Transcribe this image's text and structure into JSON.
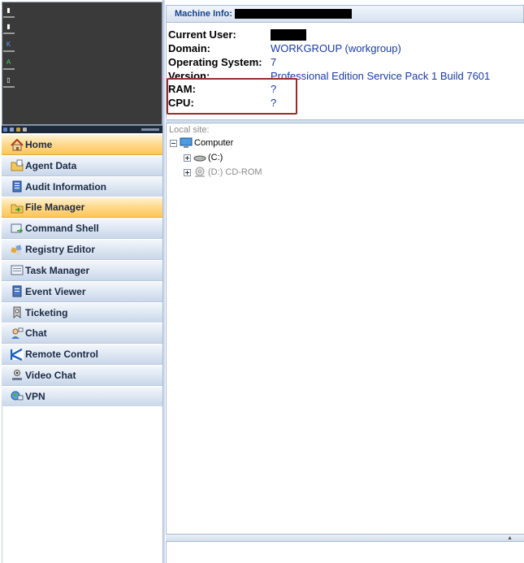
{
  "machine_info": {
    "header_label": "Machine Info:",
    "rows": [
      {
        "key": "Current User:",
        "value": ""
      },
      {
        "key": "Domain:",
        "value": "WORKGROUP (workgroup)"
      },
      {
        "key": "Operating System:",
        "value": "7"
      },
      {
        "key": "Version:",
        "value": "Professional Edition Service Pack 1 Build 7601"
      },
      {
        "key": "RAM:",
        "value": "?"
      },
      {
        "key": "CPU:",
        "value": "?"
      }
    ]
  },
  "nav": {
    "items": [
      {
        "label": "Home",
        "icon": "home-icon",
        "active": true
      },
      {
        "label": "Agent Data",
        "icon": "agent-data-icon"
      },
      {
        "label": "Audit Information",
        "icon": "audit-icon"
      },
      {
        "label": "File Manager",
        "icon": "file-manager-icon",
        "active": true
      },
      {
        "label": "Command Shell",
        "icon": "command-shell-icon"
      },
      {
        "label": "Registry Editor",
        "icon": "registry-icon"
      },
      {
        "label": "Task Manager",
        "icon": "task-manager-icon"
      },
      {
        "label": "Event Viewer",
        "icon": "event-viewer-icon"
      },
      {
        "label": "Ticketing",
        "icon": "ticketing-icon"
      },
      {
        "label": "Chat",
        "icon": "chat-icon"
      },
      {
        "label": "Remote Control",
        "icon": "remote-control-icon"
      },
      {
        "label": "Video Chat",
        "icon": "video-chat-icon"
      },
      {
        "label": "VPN",
        "icon": "vpn-icon"
      }
    ]
  },
  "file_tree": {
    "title": "Local site:",
    "root": "Computer",
    "drives": [
      "(C:)",
      "(D:) CD-ROM"
    ]
  },
  "colors": {
    "active_nav": "#ffc55a",
    "value_text": "#1a3c9e",
    "highlight_border": "#9b2b2b"
  }
}
